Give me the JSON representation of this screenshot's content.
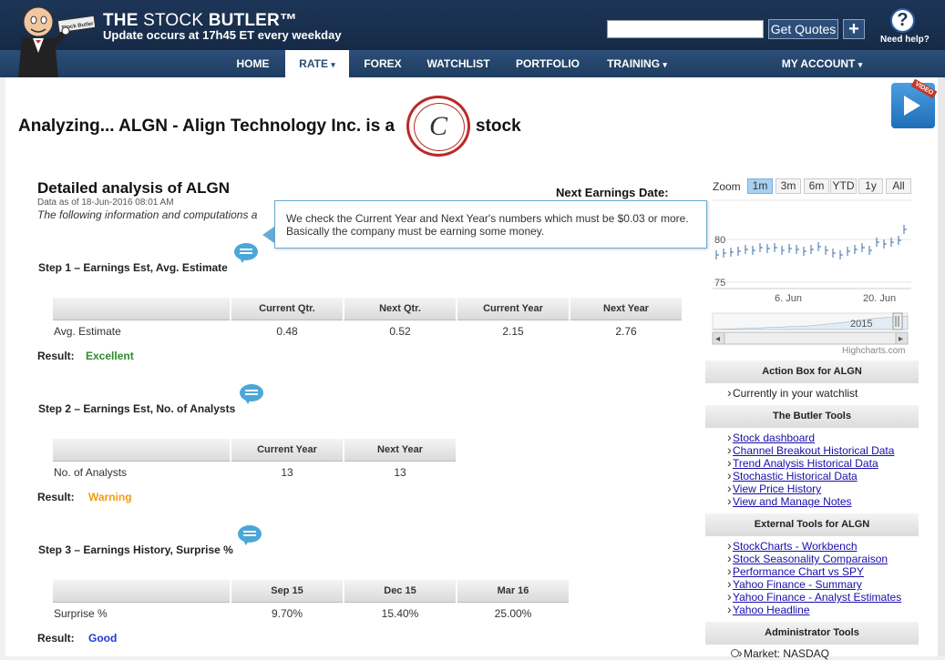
{
  "header": {
    "brand_the": "THE",
    "brand_stock": "STOCK",
    "brand_butler": "BUTLER™",
    "subtitle": "Update occurs at 17h45 ET every weekday",
    "get_quotes": "Get Quotes",
    "plus": "+",
    "help_icon": "?",
    "help_label": "Need help?",
    "mascot_sign": "Stock Butler"
  },
  "nav": {
    "home": "HOME",
    "rate": "RATE",
    "forex": "FOREX",
    "watchlist": "WATCHLIST",
    "portfolio": "PORTFOLIO",
    "training": "TRAINING",
    "my_account": "MY ACCOUNT",
    "caret": "▾"
  },
  "headline": {
    "prefix": "Analyzing... ALGN - Align Technology Inc. is a",
    "grade": "C",
    "suffix": "stock",
    "video_tag": "VIDEO"
  },
  "detail": {
    "title": "Detailed analysis of ALGN",
    "data_as_of": "Data as of 18-Jun-2016 08:01 AM",
    "intro": "The following information and computations a",
    "next_earnings": "Next Earnings Date:"
  },
  "tooltip": {
    "text": "We check the Current Year and Next Year's numbers which must be $0.03 or more. Basically the company must be earning some money."
  },
  "step1": {
    "title": "Step 1 – Earnings Est, Avg. Estimate",
    "headers": [
      "Current Qtr.",
      "Next Qtr.",
      "Current Year",
      "Next Year"
    ],
    "row_label": "Avg. Estimate",
    "values": [
      "0.48",
      "0.52",
      "2.15",
      "2.76"
    ],
    "result_label": "Result:",
    "result": "Excellent",
    "result_color": "#2e8b2e"
  },
  "step2": {
    "title": "Step 2 – Earnings Est, No. of Analysts",
    "headers": [
      "Current Year",
      "Next Year"
    ],
    "row_label": "No. of Analysts",
    "values": [
      "13",
      "13"
    ],
    "result_label": "Result:",
    "result": "Warning",
    "result_color": "#f39c12"
  },
  "step3": {
    "title": "Step 3 – Earnings History, Surprise %",
    "headers": [
      "Sep 15",
      "Dec 15",
      "Mar 16"
    ],
    "row_label": "Surprise %",
    "values": [
      "9.70%",
      "15.40%",
      "25.00%"
    ],
    "result_label": "Result:",
    "result": "Good",
    "result_color": "#1a3ad6"
  },
  "chart": {
    "zoom_label": "Zoom",
    "zoom_options": [
      "1m",
      "3m",
      "6m",
      "YTD",
      "1y",
      "All"
    ],
    "selected": "1m",
    "y_tick_80": "80",
    "y_tick_75": "75",
    "x_tick_1": "6. Jun",
    "x_tick_2": "20. Jun",
    "navigator_year": "2015",
    "credit": "Highcharts.com",
    "scroll_left": "◂",
    "scroll_right": "▸"
  },
  "chart_data": {
    "type": "line",
    "y_ticks": [
      75,
      80
    ],
    "x_ticks": [
      "6. Jun",
      "20. Jun"
    ]
  },
  "sidebar": {
    "action_box_title": "Action Box for ALGN",
    "action_items": [
      "Currently in your watchlist"
    ],
    "butler_tools_title": "The Butler Tools",
    "butler_links": [
      "Stock dashboard",
      "Channel Breakout Historical Data",
      "Trend Analysis Historical Data",
      "Stochastic Historical Data",
      "View Price History",
      "View and Manage Notes"
    ],
    "external_title": "External Tools for ALGN",
    "external_links": [
      "StockCharts - Workbench",
      "Stock Seasonality Comparaison",
      "Performance Chart vs SPY",
      "Yahoo Finance - Summary",
      "Yahoo Finance - Analyst Estimates",
      "Yahoo Headline"
    ],
    "admin_title": "Administrator Tools",
    "admin_items": [
      "Market: NASDAQ"
    ]
  },
  "colors": {
    "header_bg": "#1d3557",
    "nav_bg": "#2b4e78",
    "link": "#1a0dab",
    "grade_ring": "#b92b27",
    "tooltip_border": "#6aa9d6"
  }
}
